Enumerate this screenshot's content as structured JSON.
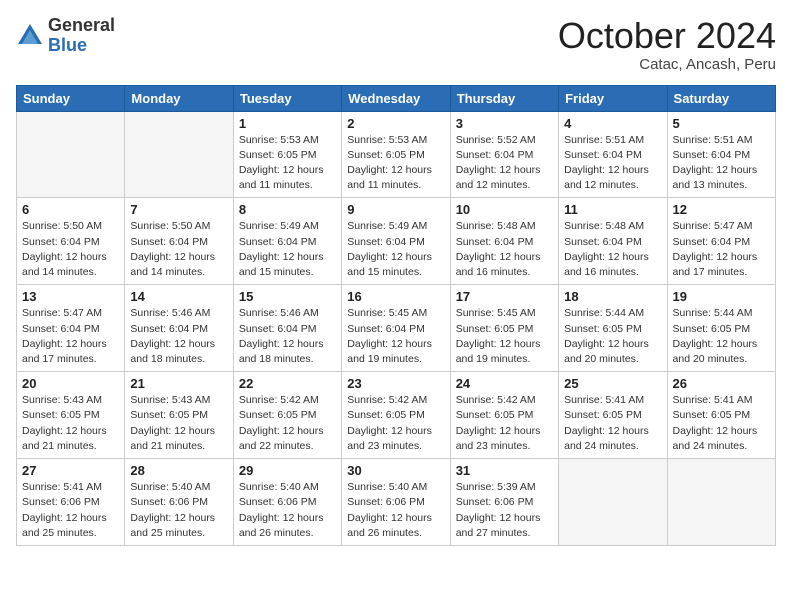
{
  "header": {
    "logo": {
      "general": "General",
      "blue": "Blue"
    },
    "title": "October 2024",
    "subtitle": "Catac, Ancash, Peru"
  },
  "columns": [
    "Sunday",
    "Monday",
    "Tuesday",
    "Wednesday",
    "Thursday",
    "Friday",
    "Saturday"
  ],
  "weeks": [
    [
      {
        "day": "",
        "info": ""
      },
      {
        "day": "",
        "info": ""
      },
      {
        "day": "1",
        "info": "Sunrise: 5:53 AM\nSunset: 6:05 PM\nDaylight: 12 hours and 11 minutes."
      },
      {
        "day": "2",
        "info": "Sunrise: 5:53 AM\nSunset: 6:05 PM\nDaylight: 12 hours and 11 minutes."
      },
      {
        "day": "3",
        "info": "Sunrise: 5:52 AM\nSunset: 6:04 PM\nDaylight: 12 hours and 12 minutes."
      },
      {
        "day": "4",
        "info": "Sunrise: 5:51 AM\nSunset: 6:04 PM\nDaylight: 12 hours and 12 minutes."
      },
      {
        "day": "5",
        "info": "Sunrise: 5:51 AM\nSunset: 6:04 PM\nDaylight: 12 hours and 13 minutes."
      }
    ],
    [
      {
        "day": "6",
        "info": "Sunrise: 5:50 AM\nSunset: 6:04 PM\nDaylight: 12 hours and 14 minutes."
      },
      {
        "day": "7",
        "info": "Sunrise: 5:50 AM\nSunset: 6:04 PM\nDaylight: 12 hours and 14 minutes."
      },
      {
        "day": "8",
        "info": "Sunrise: 5:49 AM\nSunset: 6:04 PM\nDaylight: 12 hours and 15 minutes."
      },
      {
        "day": "9",
        "info": "Sunrise: 5:49 AM\nSunset: 6:04 PM\nDaylight: 12 hours and 15 minutes."
      },
      {
        "day": "10",
        "info": "Sunrise: 5:48 AM\nSunset: 6:04 PM\nDaylight: 12 hours and 16 minutes."
      },
      {
        "day": "11",
        "info": "Sunrise: 5:48 AM\nSunset: 6:04 PM\nDaylight: 12 hours and 16 minutes."
      },
      {
        "day": "12",
        "info": "Sunrise: 5:47 AM\nSunset: 6:04 PM\nDaylight: 12 hours and 17 minutes."
      }
    ],
    [
      {
        "day": "13",
        "info": "Sunrise: 5:47 AM\nSunset: 6:04 PM\nDaylight: 12 hours and 17 minutes."
      },
      {
        "day": "14",
        "info": "Sunrise: 5:46 AM\nSunset: 6:04 PM\nDaylight: 12 hours and 18 minutes."
      },
      {
        "day": "15",
        "info": "Sunrise: 5:46 AM\nSunset: 6:04 PM\nDaylight: 12 hours and 18 minutes."
      },
      {
        "day": "16",
        "info": "Sunrise: 5:45 AM\nSunset: 6:04 PM\nDaylight: 12 hours and 19 minutes."
      },
      {
        "day": "17",
        "info": "Sunrise: 5:45 AM\nSunset: 6:05 PM\nDaylight: 12 hours and 19 minutes."
      },
      {
        "day": "18",
        "info": "Sunrise: 5:44 AM\nSunset: 6:05 PM\nDaylight: 12 hours and 20 minutes."
      },
      {
        "day": "19",
        "info": "Sunrise: 5:44 AM\nSunset: 6:05 PM\nDaylight: 12 hours and 20 minutes."
      }
    ],
    [
      {
        "day": "20",
        "info": "Sunrise: 5:43 AM\nSunset: 6:05 PM\nDaylight: 12 hours and 21 minutes."
      },
      {
        "day": "21",
        "info": "Sunrise: 5:43 AM\nSunset: 6:05 PM\nDaylight: 12 hours and 21 minutes."
      },
      {
        "day": "22",
        "info": "Sunrise: 5:42 AM\nSunset: 6:05 PM\nDaylight: 12 hours and 22 minutes."
      },
      {
        "day": "23",
        "info": "Sunrise: 5:42 AM\nSunset: 6:05 PM\nDaylight: 12 hours and 23 minutes."
      },
      {
        "day": "24",
        "info": "Sunrise: 5:42 AM\nSunset: 6:05 PM\nDaylight: 12 hours and 23 minutes."
      },
      {
        "day": "25",
        "info": "Sunrise: 5:41 AM\nSunset: 6:05 PM\nDaylight: 12 hours and 24 minutes."
      },
      {
        "day": "26",
        "info": "Sunrise: 5:41 AM\nSunset: 6:05 PM\nDaylight: 12 hours and 24 minutes."
      }
    ],
    [
      {
        "day": "27",
        "info": "Sunrise: 5:41 AM\nSunset: 6:06 PM\nDaylight: 12 hours and 25 minutes."
      },
      {
        "day": "28",
        "info": "Sunrise: 5:40 AM\nSunset: 6:06 PM\nDaylight: 12 hours and 25 minutes."
      },
      {
        "day": "29",
        "info": "Sunrise: 5:40 AM\nSunset: 6:06 PM\nDaylight: 12 hours and 26 minutes."
      },
      {
        "day": "30",
        "info": "Sunrise: 5:40 AM\nSunset: 6:06 PM\nDaylight: 12 hours and 26 minutes."
      },
      {
        "day": "31",
        "info": "Sunrise: 5:39 AM\nSunset: 6:06 PM\nDaylight: 12 hours and 27 minutes."
      },
      {
        "day": "",
        "info": ""
      },
      {
        "day": "",
        "info": ""
      }
    ]
  ]
}
